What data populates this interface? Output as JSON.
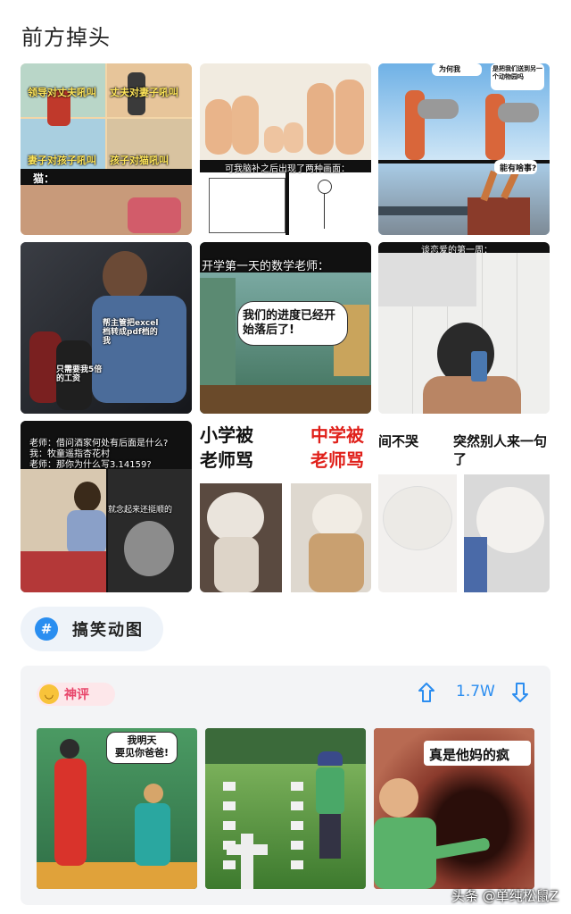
{
  "section_title": "前方掉头",
  "memes": [
    {
      "captions": [
        "领导对丈夫吼叫",
        "丈夫对妻子吼叫",
        "妻子对孩子吼叫",
        "孩子对猫吼叫",
        "猫："
      ]
    },
    {
      "captions": [
        "可我脑补之后出现了两种画面："
      ]
    },
    {
      "captions": [
        "为何我",
        "是把我们送到另一个动物园吗",
        "能有啥事?"
      ]
    },
    {
      "captions": [
        "帮主管把excel档转成pdf档的我",
        "只需要我5倍的工资"
      ]
    },
    {
      "captions": [
        "开学第一天的数学老师：",
        "我们的进度已经开始落后了!"
      ]
    },
    {
      "captions": [
        "谈恋爱的第一周："
      ]
    },
    {
      "captions": [
        "老师：借问酒家何处有后面是什么?",
        "我：牧童遥指杏花村",
        "老师：那你为什么写3.14159?",
        "就念起来还挺顺的"
      ]
    },
    {
      "captions": [
        "小学被",
        "老师骂",
        "中学被",
        "老师骂"
      ]
    },
    {
      "captions": [
        "间不哭",
        "突然别人来一句",
        "了"
      ]
    }
  ],
  "tag": {
    "label": "搞笑动图",
    "icon": "hash-icon"
  },
  "comment": {
    "badge": "神评",
    "upvote_icon": "arrow-up-icon",
    "count": "1.7W",
    "downvote_icon": "arrow-down-icon",
    "thumbs": [
      {
        "caption": "我明天\n要见你爸爸!"
      },
      {
        "caption": ""
      },
      {
        "caption": "真是他妈的疯"
      }
    ]
  },
  "watermark": "头条 @单纯松鼠Z",
  "colors": {
    "accent": "#2b8df0",
    "badge": "#e8456a"
  }
}
